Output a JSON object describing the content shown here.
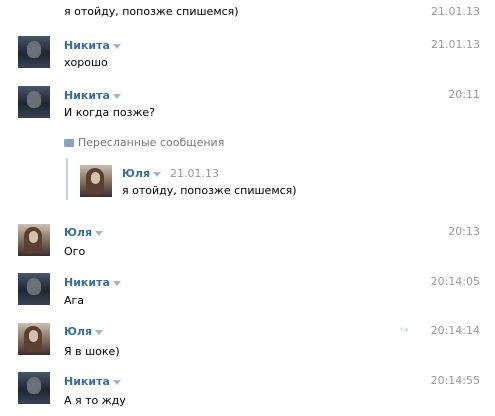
{
  "top_message": {
    "text": "я отойду, попозже спишемся)",
    "time": "21.01.13"
  },
  "messages": [
    {
      "author": "Никита",
      "text": "хорошо",
      "time": "21.01.13"
    },
    {
      "author": "Никита",
      "text": "И когда позже?",
      "time": "20:11"
    },
    {
      "author": "Юля",
      "text": "Ого",
      "time": "20:13"
    },
    {
      "author": "Никита",
      "text": "Ага",
      "time": "20:14:05"
    },
    {
      "author": "Юля",
      "text": "Я в шоке)",
      "time": "20:14:14"
    },
    {
      "author": "Никита",
      "text": "А я то жду",
      "time": "20:14:55"
    }
  ],
  "forwarded": {
    "label": "Пересланные сообщения",
    "author": "Юля",
    "date": "21.01.13",
    "text": "я отойду, попозже спишемся)"
  },
  "icons": {
    "forward": "forward-message-icon",
    "reply": "reply-arrow-icon",
    "author_menu": "caret-down-icon"
  },
  "colors": {
    "author": "#3d6e8e",
    "timestamp": "#999999",
    "forward_bar": "#c5d3e1"
  }
}
